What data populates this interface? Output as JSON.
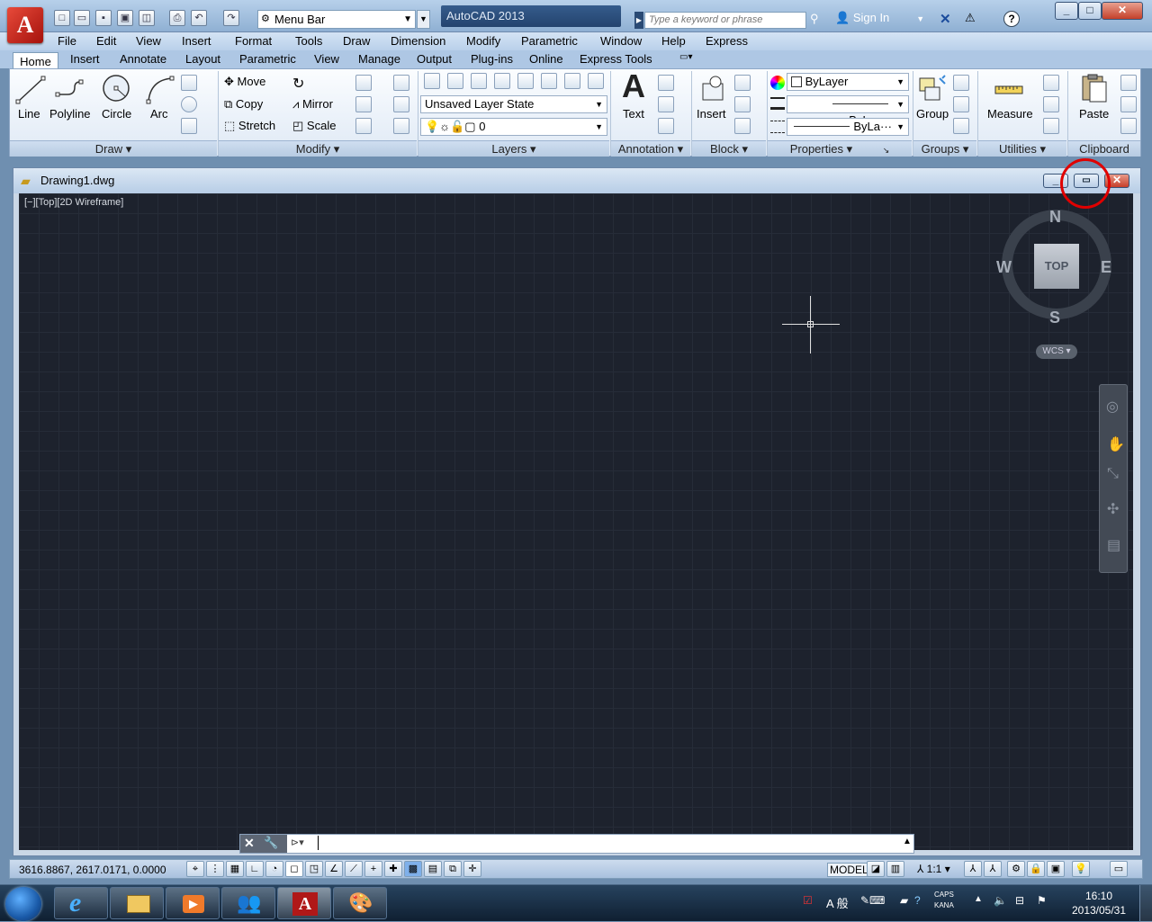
{
  "app": {
    "name": "AutoCAD 2013",
    "document": "Drawing1.dwg",
    "logo": "A"
  },
  "quick_access": {
    "workspace": "Menu Bar"
  },
  "search": {
    "placeholder": "Type a keyword or phrase"
  },
  "account": {
    "signin": "Sign In"
  },
  "menu": [
    "File",
    "Edit",
    "View",
    "Insert",
    "Format",
    "Tools",
    "Draw",
    "Dimension",
    "Modify",
    "Parametric",
    "Window",
    "Help",
    "Express"
  ],
  "tabs": [
    "Home",
    "Insert",
    "Annotate",
    "Layout",
    "Parametric",
    "View",
    "Manage",
    "Output",
    "Plug-ins",
    "Online",
    "Express Tools"
  ],
  "ribbon": {
    "draw": {
      "line": "Line",
      "polyline": "Polyline",
      "circle": "Circle",
      "arc": "Arc",
      "panel": "Draw"
    },
    "modify": {
      "move": "Move",
      "copy": "Copy",
      "stretch": "Stretch",
      "mirror": "Mirror",
      "scale": "Scale",
      "panel": "Modify"
    },
    "layers": {
      "state": "Unsaved Layer State",
      "current": "0",
      "panel": "Layers"
    },
    "annotation": {
      "text": "Text",
      "panel": "Annotation"
    },
    "block": {
      "insert": "Insert",
      "panel": "Block"
    },
    "properties": {
      "color": "ByLayer",
      "lineweight": "ByLayer",
      "linetype": "ByLa···",
      "panel": "Properties"
    },
    "groups": {
      "group": "Group",
      "panel": "Groups"
    },
    "utilities": {
      "measure": "Measure",
      "panel": "Utilities"
    },
    "clipboard": {
      "paste": "Paste",
      "panel": "Clipboard"
    }
  },
  "viewport": {
    "label": "[−][Top][2D Wireframe]",
    "cube": "TOP",
    "north": "N",
    "south": "S",
    "east": "E",
    "west": "W",
    "ucs": "WCS"
  },
  "status": {
    "coords": "3616.8867, 2617.0171, 0.0000",
    "model": "MODEL",
    "scale": "1:1"
  },
  "taskbar": {
    "time": "16:10",
    "date": "2013/05/31",
    "caps": "CAPS",
    "kana": "KANA",
    "ime_mode": "A 般"
  },
  "colors": {
    "canvas": "#1d222d",
    "highlight_circle": "#e00000"
  }
}
